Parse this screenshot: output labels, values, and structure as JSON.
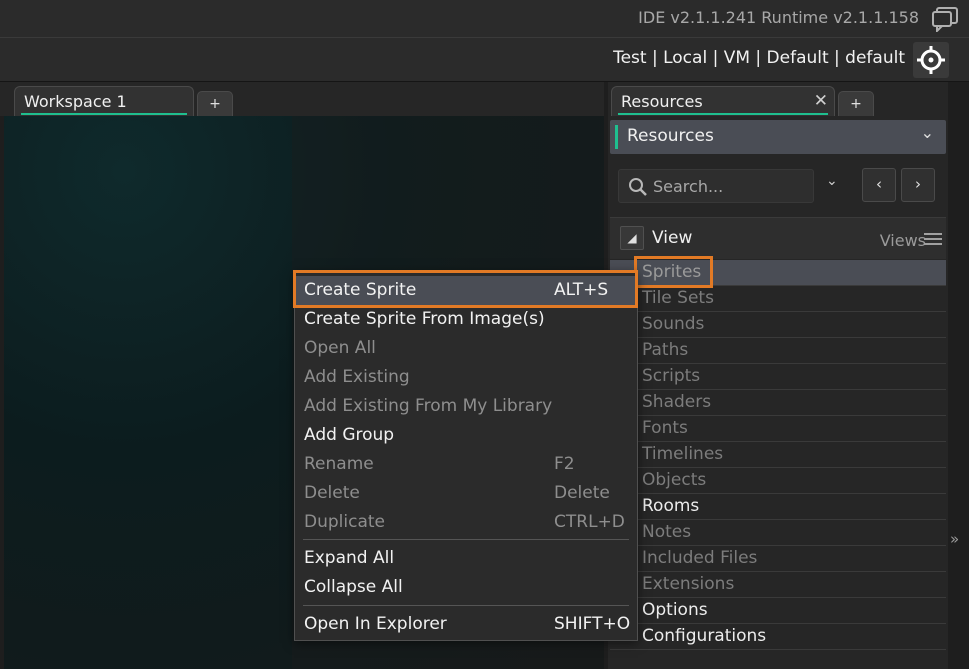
{
  "titlebar": {
    "version": "IDE v2.1.1.241 Runtime v2.1.1.158",
    "icon": "chat-bubble-icon"
  },
  "targetbar": {
    "targets": "Test | Local | VM | Default | default",
    "icon": "crosshair-target-icon"
  },
  "workspace": {
    "tab_label": "Workspace 1",
    "add_tab": "+"
  },
  "resources": {
    "tab_label": "Resources",
    "close": "✕",
    "add_tab": "+",
    "dropdown_label": "Resources",
    "dropdown_chevron": "⌄",
    "search_placeholder": "Search...",
    "search_chevron": "⌄",
    "prev": "‹",
    "next": "›",
    "view_label": "View",
    "views_label": "Views",
    "items": [
      {
        "label": "Sprites",
        "state": "selected"
      },
      {
        "label": "Tile Sets",
        "state": "dim"
      },
      {
        "label": "Sounds",
        "state": "dim"
      },
      {
        "label": "Paths",
        "state": "dim"
      },
      {
        "label": "Scripts",
        "state": "dim"
      },
      {
        "label": "Shaders",
        "state": "dim"
      },
      {
        "label": "Fonts",
        "state": "dim"
      },
      {
        "label": "Timelines",
        "state": "dim"
      },
      {
        "label": "Objects",
        "state": "dim"
      },
      {
        "label": "Rooms",
        "state": "bright"
      },
      {
        "label": "Notes",
        "state": "dim"
      },
      {
        "label": "Included Files",
        "state": "dim"
      },
      {
        "label": "Extensions",
        "state": "dim"
      },
      {
        "label": "Options",
        "state": "bright"
      },
      {
        "label": "Configurations",
        "state": "bright"
      }
    ]
  },
  "context_menu": {
    "items": [
      {
        "label": "Create Sprite",
        "shortcut": "ALT+S",
        "enabled": true
      },
      {
        "label": "Create Sprite From Image(s)",
        "shortcut": "",
        "enabled": true
      },
      {
        "label": "Open All",
        "shortcut": "",
        "enabled": false
      },
      {
        "label": "Add Existing",
        "shortcut": "",
        "enabled": false
      },
      {
        "label": "Add Existing From My Library",
        "shortcut": "",
        "enabled": false
      },
      {
        "label": "Add Group",
        "shortcut": "",
        "enabled": true
      },
      {
        "label": "Rename",
        "shortcut": "F2",
        "enabled": false
      },
      {
        "label": "Delete",
        "shortcut": "Delete",
        "enabled": false
      },
      {
        "label": "Duplicate",
        "shortcut": "CTRL+D",
        "enabled": false
      },
      {
        "label": "Expand All",
        "shortcut": "",
        "enabled": true
      },
      {
        "label": "Collapse All",
        "shortcut": "",
        "enabled": true
      },
      {
        "label": "Open In Explorer",
        "shortcut": "SHIFT+O",
        "enabled": true
      }
    ]
  },
  "colors": {
    "accent": "#1fbf8f",
    "highlight_outline": "#e27a25",
    "selection": "#4a4d55"
  }
}
